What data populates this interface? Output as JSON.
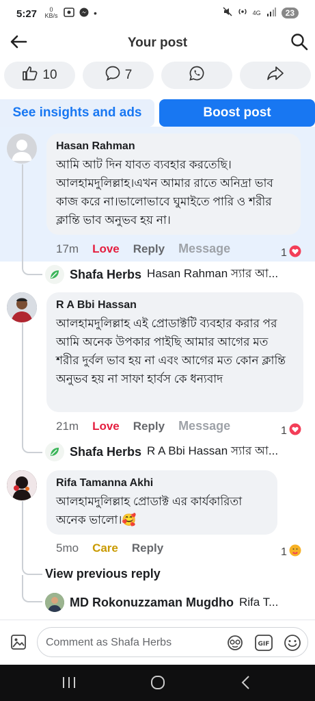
{
  "status_bar": {
    "time": "5:27",
    "data_rate": "0 KB/s",
    "network": "4G",
    "battery": "23"
  },
  "header": {
    "title": "Your post"
  },
  "stats": {
    "likes": "10",
    "comments": "7"
  },
  "actions": {
    "insights": "See insights and ads",
    "boost": "Boost post"
  },
  "comments": [
    {
      "author": "Hasan Rahman",
      "text": "আমি আট দিন যাবত ব্যবহার করতেছি। আলহামদুলিল্লাহ।এখন আমার রাতে অনিদ্রা ভাব কাজ করে না।ভালোভাবে ঘুমাইতে পারি ও শরীর ক্লান্তি ভাব অনুভব হয় না।",
      "time": "17m",
      "reaction_label": "Love",
      "reply_label": "Reply",
      "message_label": "Message",
      "reaction_count": "1",
      "reply": {
        "author": "Shafa Herbs",
        "preview": "Hasan Rahman স্যার আ..."
      }
    },
    {
      "author": "R A Bbi Hassan",
      "text": "আলহামদুলিল্লাহ এই প্রোডাক্টটি ব্যবহার করার পর আমি অনেক উপকার পাইছি আমার আগের মত শরীর দুর্বল ভাব হয় না এবং আগের মত কোন ক্লান্তি অনুভব হয় না সাফা হার্বস কে ধন্যবাদ",
      "time": "21m",
      "reaction_label": "Love",
      "reply_label": "Reply",
      "message_label": "Message",
      "reaction_count": "1",
      "reply": {
        "author": "Shafa Herbs",
        "preview": "R A Bbi Hassan স্যার আ..."
      }
    },
    {
      "author": "Rifa Tamanna Akhi",
      "text": "আলহামদুলিল্লাহ প্রোডাক্ট এর কার্যকারিতা অনেক ভালো।🥰",
      "time": "5mo",
      "reaction_label": "Care",
      "reply_label": "Reply",
      "reaction_count": "1",
      "view_previous": "View previous reply",
      "reply": {
        "author": "MD Rokonuzzaman Mugdho",
        "preview": "Rifa T..."
      }
    }
  ],
  "composer": {
    "placeholder": "Comment as Shafa Herbs"
  },
  "icons": {
    "back": "back-arrow-icon",
    "search": "search-icon",
    "like": "like-icon",
    "comment": "comment-icon",
    "whatsapp": "whatsapp-icon",
    "share": "share-icon",
    "photo": "photo-icon",
    "avatar_sticker": "avatar-sticker-icon",
    "gif": "gif-icon",
    "emoji": "emoji-icon"
  },
  "colors": {
    "accent": "#1877f2",
    "love": "#e41e3f",
    "care": "#c99a00"
  }
}
